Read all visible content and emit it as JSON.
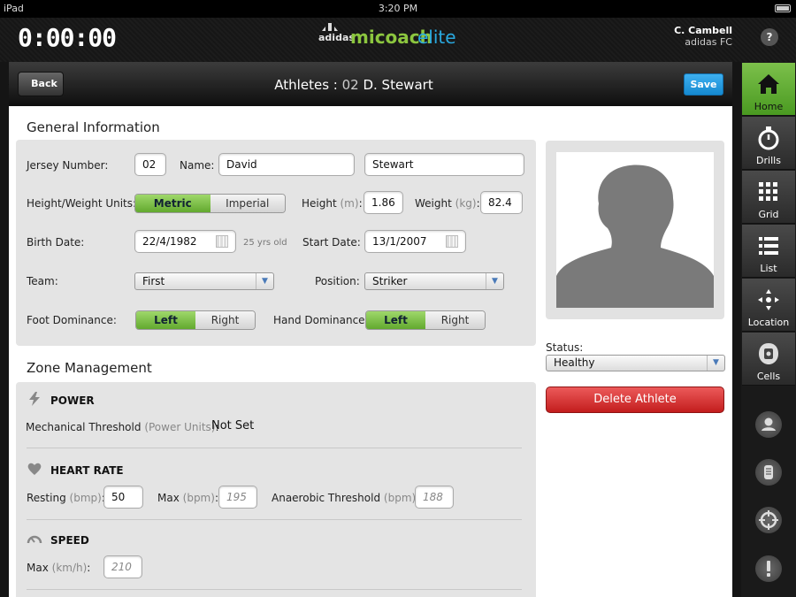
{
  "status_bar": {
    "device": "iPad",
    "time": "3:20 PM"
  },
  "header": {
    "timer": "0:00:00",
    "brand": {
      "mark": "adidas",
      "name_part1": "micoach",
      "name_part2": "elite"
    },
    "user": {
      "name": "C. Cambell",
      "club": "adidas FC"
    },
    "help": "?"
  },
  "nav": {
    "back": "Back",
    "title_prefix": "Athletes : ",
    "title_number": "02",
    "title_name": "D. Stewart",
    "save": "Save"
  },
  "rail": {
    "items": [
      {
        "label": "Home",
        "icon": "home-icon",
        "active": true
      },
      {
        "label": "Drills",
        "icon": "stopwatch-icon"
      },
      {
        "label": "Grid",
        "icon": "grid-icon"
      },
      {
        "label": "List",
        "icon": "list-icon"
      },
      {
        "label": "Location",
        "icon": "location-icon"
      },
      {
        "label": "Cells",
        "icon": "cells-icon"
      }
    ],
    "side_icons": [
      "user-icon",
      "device-icon",
      "target-icon",
      "alert-icon"
    ]
  },
  "general": {
    "heading": "General Information",
    "jersey_label": "Jersey Number:",
    "jersey_value": "02",
    "name_label": "Name:",
    "first_name": "David",
    "last_name": "Stewart",
    "units_label": "Height/Weight Units:",
    "units_options": [
      "Metric",
      "Imperial"
    ],
    "units_selected": "Metric",
    "height_label": "Height",
    "height_unit": "(m)",
    "height_value": "1.86",
    "weight_label": "Weight",
    "weight_unit": "(kg)",
    "weight_value": "82.4",
    "birth_label": "Birth Date:",
    "birth_value": "22/4/1982",
    "age_text": "25 yrs old",
    "start_label": "Start Date:",
    "start_value": "13/1/2007",
    "team_label": "Team:",
    "team_value": "First",
    "position_label": "Position:",
    "position_value": "Striker",
    "foot_label": "Foot Dominance:",
    "foot_options": [
      "Left",
      "Right"
    ],
    "foot_selected": "Left",
    "hand_label": "Hand Dominance:",
    "hand_options": [
      "Left",
      "Right"
    ],
    "hand_selected": "Left"
  },
  "side": {
    "status_label": "Status:",
    "status_value": "Healthy",
    "delete": "Delete Athlete"
  },
  "zones": {
    "heading": "Zone Management",
    "power": {
      "title": "POWER",
      "threshold_label": "Mechanical Threshold",
      "threshold_unit": "(Power Units)",
      "threshold_value": "Not Set"
    },
    "heart": {
      "title": "HEART RATE",
      "resting_label": "Resting",
      "resting_unit": "(bmp)",
      "resting_value": "50",
      "max_label": "Max",
      "max_unit": "(bpm)",
      "max_value": "195",
      "anaerobic_label": "Anaerobic Threshold",
      "anaerobic_unit": "(bpm)",
      "anaerobic_value": "188"
    },
    "speed": {
      "title": "SPEED",
      "max_label": "Max",
      "max_unit": "(km/h)",
      "max_value": "210"
    }
  },
  "colors": {
    "accent_green": "#62a92e",
    "save_blue": "#1589d0",
    "delete_red": "#c31d1d",
    "brand_blue": "#29a9e0",
    "brand_green": "#8cc63f"
  }
}
